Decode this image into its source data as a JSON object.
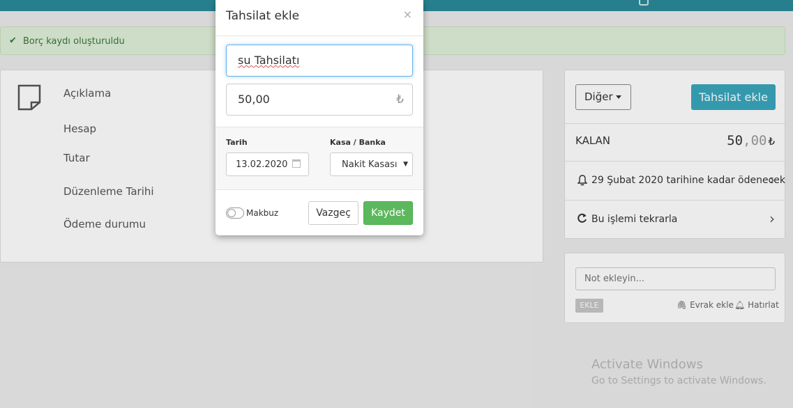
{
  "alert": {
    "icon": "check-icon",
    "message": "Borç kaydı oluşturuldu"
  },
  "detail": {
    "icon": "note-icon",
    "labels": [
      "Açıklama",
      "Hesap",
      "Tutar",
      "Düzenleme Tarihi",
      "Ödeme durumu"
    ]
  },
  "actions": {
    "other_label": "Diğer",
    "collect_label": "Tahsilat ekle"
  },
  "remaining": {
    "label": "KALAN",
    "integer": "50",
    "decimal": ",00",
    "currency": "₺"
  },
  "due_row": {
    "icon": "bell-icon",
    "text": "29 Şubat 2020 tarihine kadar ödenecek"
  },
  "repeat_row": {
    "icon": "refresh-icon",
    "text": "Bu işlemi tekrarla"
  },
  "notes": {
    "placeholder": "Not ekleyin...",
    "add_label": "EKLE",
    "attach_label": "Evrak ekle",
    "remind_label": "Hatırlat"
  },
  "modal": {
    "title": "Tahsilat ekle",
    "close": "×",
    "description_value": "su Tahsilatı",
    "amount_value": "50,00",
    "currency": "₺",
    "date_label": "Tarih",
    "date_value": "13.02.2020",
    "bank_label": "Kasa / Banka",
    "bank_value": "Nakit Kasası",
    "receipt_label": "Makbuz",
    "receipt_on": false,
    "cancel_label": "Vazgeç",
    "save_label": "Kaydet"
  },
  "watermark": {
    "title": "Activate Windows",
    "subtitle": "Go to Settings to activate Windows."
  },
  "colors": {
    "navbar": "#2b8a9b",
    "primary": "#3aa7bd",
    "success": "#5cb85c",
    "alert_bg": "#dff0d8"
  }
}
